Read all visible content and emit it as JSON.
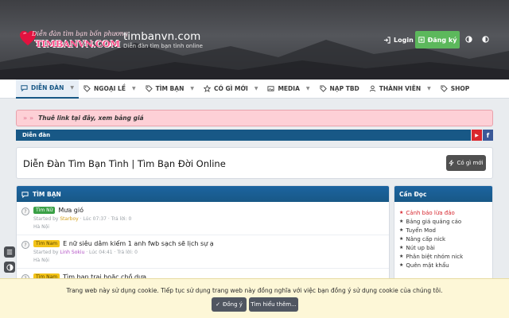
{
  "header": {
    "logo_script": "Diễn đàn tìm bạn bốn phương",
    "logo_brand": "TIMBANVN.COM",
    "site_title": "timbanvn.com",
    "site_subtitle": "Diễn đàn tìm bạn tình online",
    "login_label": "Login",
    "register_label": "Đăng ký"
  },
  "nav": {
    "items": [
      {
        "label": "DIỄN ĐÀN",
        "icon": "chat-icon",
        "has_caret": true
      },
      {
        "label": "NGOẠI LỀ",
        "icon": "tag-icon",
        "has_caret": true
      },
      {
        "label": "TÌM BẠN",
        "icon": "tag-icon",
        "has_caret": true
      },
      {
        "label": "CÓ GÌ MỚI",
        "icon": "star-icon",
        "has_caret": true
      },
      {
        "label": "MEDIA",
        "icon": "image-icon",
        "has_caret": true
      },
      {
        "label": "NẠP TBD",
        "icon": "tag-icon",
        "has_caret": false
      },
      {
        "label": "THÀNH VIÊN",
        "icon": "user-icon",
        "has_caret": true
      },
      {
        "label": "SHOP",
        "icon": "tag-icon",
        "has_caret": false
      }
    ]
  },
  "notice": {
    "arrows": "» »",
    "text": "Thuê link tại đây, xem bảng giá"
  },
  "breadcrumb": {
    "label": "Diễn đàn"
  },
  "social": {
    "youtube": "▶",
    "facebook": "f"
  },
  "page": {
    "title": "Diễn Đàn Tìm Bạn Tình | Tìm Bạn Đời Online",
    "new_button": "Có gì mới"
  },
  "block": {
    "title": "TÌM BẠN",
    "threads": [
      {
        "avatar": "?",
        "badge": "Tìm Nữ",
        "badge_color": "green",
        "title": "Mưa gió",
        "started_by": "Started by",
        "user": "Starboy",
        "meta": "· Lúc 07:37 · Trả lời: 0",
        "location": "Hà Nội"
      },
      {
        "avatar": "?",
        "badge": "Tìm Nam",
        "badge_color": "yellow",
        "title": "E nữ siêu dâm kiếm 1 anh fwb sạch sẽ lịch sự ạ",
        "started_by": "Started by",
        "user": "Linh Sokiu",
        "meta": "· Lúc 04:41 · Trả lời: 0",
        "location": "Hà Nội"
      },
      {
        "avatar": "?",
        "badge": "Tìm Nam",
        "badge_color": "yellow",
        "title": "Tìm bạn trai hoặc chồ dựa",
        "started_by": "",
        "user": "",
        "meta": "",
        "location": ""
      }
    ]
  },
  "sidebar": {
    "title": "Cần Đọc",
    "items": [
      {
        "label": "Cảnh báo lừa đảo",
        "red": true
      },
      {
        "label": "Bảng giá quảng cáo",
        "red": false
      },
      {
        "label": "Tuyển Mod",
        "red": false
      },
      {
        "label": "Nâng cấp nick",
        "red": false
      },
      {
        "label": "Nút up bài",
        "red": false
      },
      {
        "label": "Phân biệt nhóm nick",
        "red": false
      },
      {
        "label": "Quên mật khẩu",
        "red": false
      }
    ]
  },
  "cookie": {
    "message": "Trang web này sử dụng cookie. Tiếp tục sử dụng trang web này đồng nghĩa với việc bạn đồng ý sử dụng cookie của chúng tôi.",
    "accept_label": "Đồng ý",
    "learn_label": "Tìm hiểu thêm..."
  },
  "colors": {
    "primary": "#185886",
    "register": "#5cb85c",
    "notice_bg": "#fdd0d6",
    "cookie_bg": "#fdf7d7"
  }
}
